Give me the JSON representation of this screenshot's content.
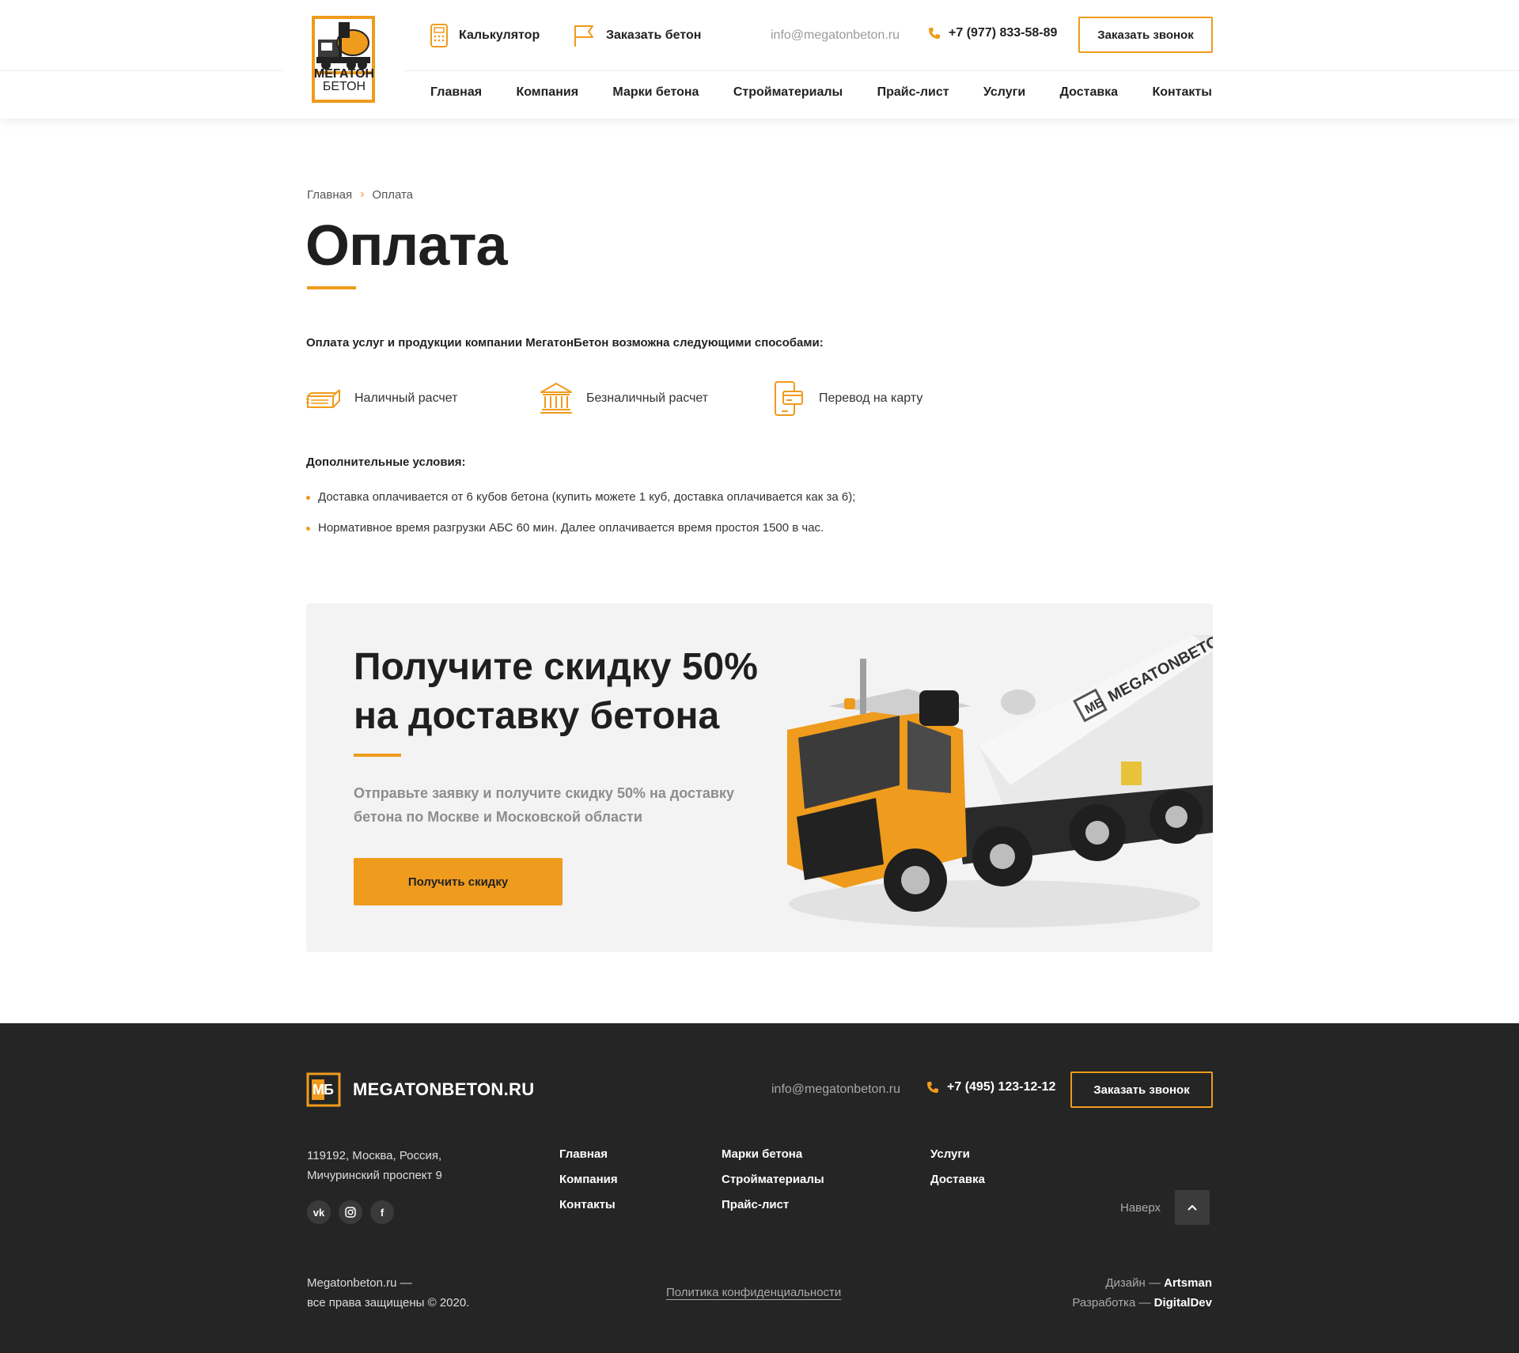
{
  "colors": {
    "accent": "#ef9b1d",
    "footer_bg": "#252525",
    "promo_bg": "#f3f3f3"
  },
  "header": {
    "logo": {
      "line1": "МЕГАТОН",
      "line2": "БЕТОН",
      "icon": "concrete-mixer-logo"
    },
    "calculator": {
      "label": "Калькулятор",
      "icon": "calculator-icon"
    },
    "order_concrete": {
      "label": "Заказать бетон",
      "icon": "flag-icon"
    },
    "email": "info@megatonbeton.ru",
    "phone": "+7 (977) 833-58-89",
    "callback_button": "Заказать звонок",
    "nav": [
      "Главная",
      "Компания",
      "Марки бетона",
      "Стройматериалы",
      "Прайс-лист",
      "Услуги",
      "Доставка",
      "Контакты"
    ]
  },
  "breadcrumb": {
    "home": "Главная",
    "current": "Оплата"
  },
  "page": {
    "title": "Оплата",
    "intro": "Оплата услуг и продукции компании МегатонБетон возможна следующими способами:",
    "methods": [
      {
        "label": "Наличный расчет",
        "icon": "cash-icon"
      },
      {
        "label": "Безналичный расчет",
        "icon": "bank-icon"
      },
      {
        "label": "Перевод на карту",
        "icon": "card-transfer-icon"
      }
    ],
    "extra_title": "Дополнительные условия:",
    "conditions": [
      "Доставка оплачивается от 6 кубов бетона (купить можете 1 куб, доставка оплачивается как за 6);",
      "Нормативное время разгрузки АБС 60 мин. Далее оплачивается время простоя 1500 в час."
    ]
  },
  "promo": {
    "title_line1": "Получите скидку 50%",
    "title_line2": "на доставку бетона",
    "text": "Отправьте заявку и получите скидку 50% на доставку бетона по Москве и Московской области",
    "button": "Получить скидку",
    "truck_brand": "MEGATONBETON.RU",
    "truck_badge": "МБ"
  },
  "footer": {
    "logo_badge": "МБ",
    "brand": "MEGATONBETON.RU",
    "email": "info@megatonbeton.ru",
    "phone": "+7 (495) 123-12-12",
    "callback_button": "Заказать звонок",
    "address_line1": "119192, Москва, Россия,",
    "address_line2": "Мичуринский проспект 9",
    "social": [
      {
        "label": "vk",
        "icon": "vk-icon"
      },
      {
        "label": "",
        "icon": "instagram-icon"
      },
      {
        "label": "f",
        "icon": "facebook-icon"
      }
    ],
    "col1": [
      "Главная",
      "Компания",
      "Контакты"
    ],
    "col2": [
      "Марки бетона",
      "Стройматериалы",
      "Прайс-лист"
    ],
    "col3": [
      "Услуги",
      "Доставка"
    ],
    "to_top": "Наверх",
    "copyright_line1": "Megatonbeton.ru —",
    "copyright_line2": "все права защищены © 2020.",
    "policy": "Политика конфиденциальности",
    "design_label": "Дизайн —",
    "design_name": "Artsman",
    "dev_label": "Разработка —",
    "dev_name": "DigitalDev"
  }
}
